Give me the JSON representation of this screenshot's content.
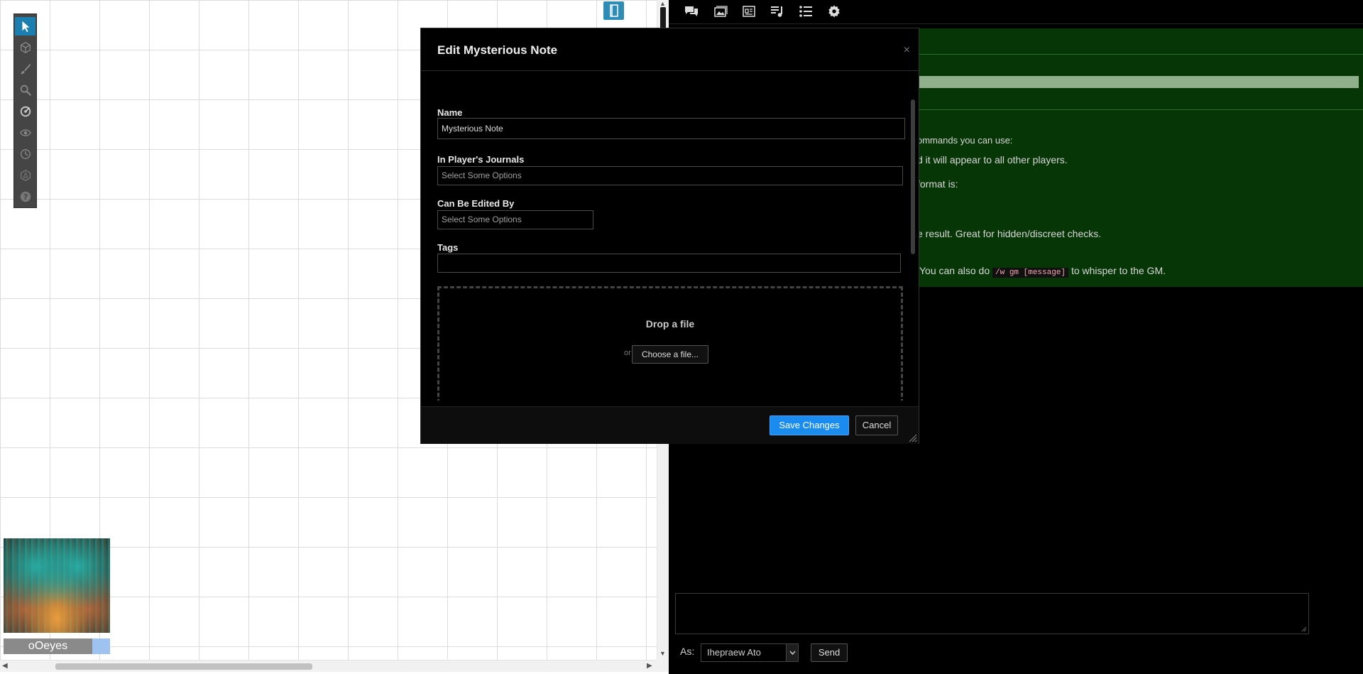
{
  "avatar": {
    "name": "oOeyes"
  },
  "modal": {
    "title": "Edit Mysterious Note",
    "close_glyph": "×",
    "fields": {
      "name_label": "Name",
      "name_value": "Mysterious Note",
      "journals_label": "In Player's Journals",
      "journals_placeholder": "Select Some Options",
      "edited_by_label": "Can Be Edited By",
      "edited_by_placeholder": "Select Some Options",
      "tags_label": "Tags",
      "tags_value": ""
    },
    "dropzone": {
      "title": "Drop a file",
      "or_text": "or",
      "choose_label": "Choose a file..."
    },
    "buttons": {
      "save": "Save Changes",
      "cancel": "Cancel"
    }
  },
  "chat": {
    "lines": [
      {
        "text": "ommands you can use:"
      },
      {
        "text": "d it will appear to all other players."
      },
      {
        "text": " format is:"
      },
      {
        "text": "e result. Great for hidden/discreet checks."
      }
    ],
    "whisper_prefix": "You can also do",
    "whisper_code": "/w gm [message]",
    "whisper_suffix": "to whisper to the GM.",
    "as_label": "As:",
    "as_value": "Ihepraew Ato",
    "send_label": "Send"
  },
  "tools": [
    "select-icon",
    "cube-icon",
    "brush-icon",
    "zoom-icon",
    "ruler-icon",
    "eye-icon",
    "clock-icon",
    "token-icon",
    "help-icon"
  ],
  "sidebar_tabs": [
    "chat-icon",
    "art-library-icon",
    "journal-icon",
    "jukebox-icon",
    "compendium-icon",
    "settings-icon"
  ],
  "colors": {
    "accent": "#1a8cf0",
    "chat_bg": "#063506",
    "tool_active": "#1b7fb0"
  }
}
